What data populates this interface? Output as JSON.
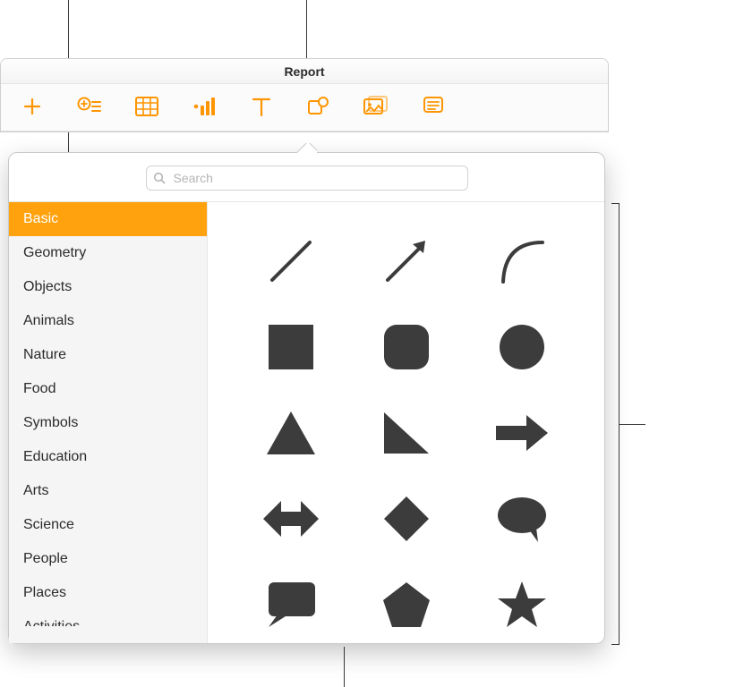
{
  "colors": {
    "accent": "#ff9500",
    "selection": "#ffa20e",
    "shape_fill": "#3c3c3c"
  },
  "window": {
    "title": "Report"
  },
  "search": {
    "placeholder": "Search",
    "value": ""
  },
  "sidebar": {
    "items": [
      {
        "label": "Basic",
        "selected": true
      },
      {
        "label": "Geometry",
        "selected": false
      },
      {
        "label": "Objects",
        "selected": false
      },
      {
        "label": "Animals",
        "selected": false
      },
      {
        "label": "Nature",
        "selected": false
      },
      {
        "label": "Food",
        "selected": false
      },
      {
        "label": "Symbols",
        "selected": false
      },
      {
        "label": "Education",
        "selected": false
      },
      {
        "label": "Arts",
        "selected": false
      },
      {
        "label": "Science",
        "selected": false
      },
      {
        "label": "People",
        "selected": false
      },
      {
        "label": "Places",
        "selected": false
      }
    ],
    "partial_next": "Activities"
  },
  "toolbar": {
    "buttons": [
      {
        "id": "add",
        "icon": "plus-icon"
      },
      {
        "id": "insert",
        "icon": "plus-circle-list-icon"
      },
      {
        "id": "table",
        "icon": "table-icon"
      },
      {
        "id": "chart",
        "icon": "bar-chart-icon"
      },
      {
        "id": "text",
        "icon": "text-icon"
      },
      {
        "id": "shape",
        "icon": "shape-icon",
        "active": true
      },
      {
        "id": "media",
        "icon": "media-icon"
      },
      {
        "id": "comment",
        "icon": "comment-lines-icon"
      }
    ]
  },
  "shapes": {
    "grid": [
      "line",
      "arrow-line",
      "curve",
      "square",
      "rounded-square",
      "circle",
      "triangle",
      "right-triangle",
      "arrow-right",
      "double-arrow",
      "diamond",
      "speech-bubble",
      "callout-rect",
      "pentagon",
      "star"
    ]
  }
}
